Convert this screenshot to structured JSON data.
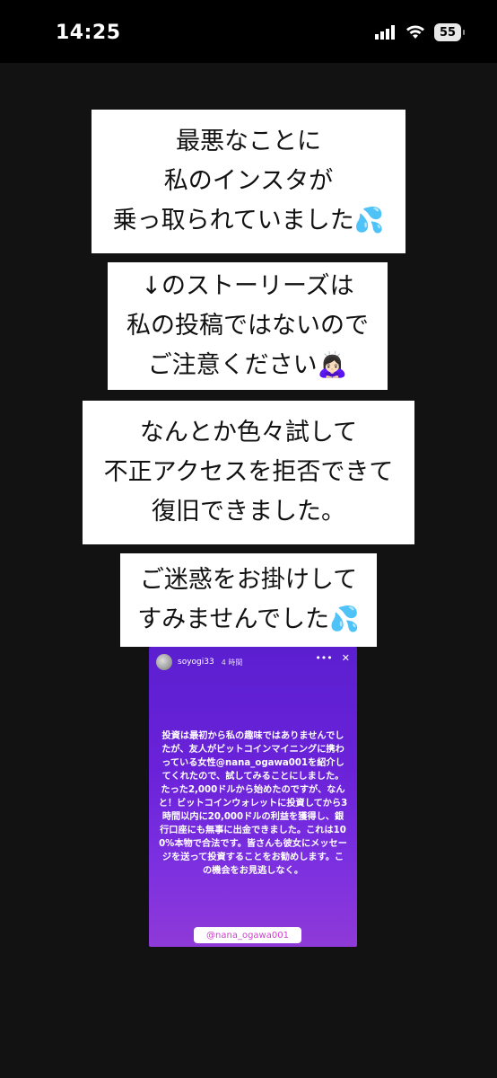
{
  "status_bar": {
    "time": "14:25",
    "battery": "55",
    "icons": [
      "signal-icon",
      "wifi-icon",
      "battery-icon"
    ]
  },
  "cards": [
    {
      "lines": [
        "最悪なことに",
        "私のインスタが",
        "乗っ取られていました💦"
      ]
    },
    {
      "lines": [
        "↓のストーリーズは",
        "私の投稿ではないので",
        "ご注意ください🙇🏻‍♀️"
      ]
    },
    {
      "lines": [
        "なんとか色々試して",
        "不正アクセスを拒否できて",
        "復旧できました。"
      ]
    },
    {
      "lines": [
        "ご迷惑をお掛けして",
        "すみませんでした💦"
      ]
    }
  ],
  "story": {
    "username": "soyogi33",
    "time": "4 時間",
    "text": "投資は最初から私の趣味ではありませんでしたが、友人がビットコインマイニングに携わっている女性@nana_ogawa001を紹介してくれたので、試してみることにしました。たった2,000ドルから始めたのですが、なんと！ビットコインウォレットに投資してから3時間以内に20,000ドルの利益を獲得し、銀行口座にも無事に出金できました。これは100%本物で合法です。皆さんも彼女にメッセージを送って投資することをお勧めします。この機会をお見逃しなく。",
    "tag": "@nana_ogawa001"
  },
  "colors": {
    "story_gradient_top": "#5b1fd0",
    "story_gradient_bottom": "#8f3ad8",
    "tag_text": "#d13ad0"
  }
}
